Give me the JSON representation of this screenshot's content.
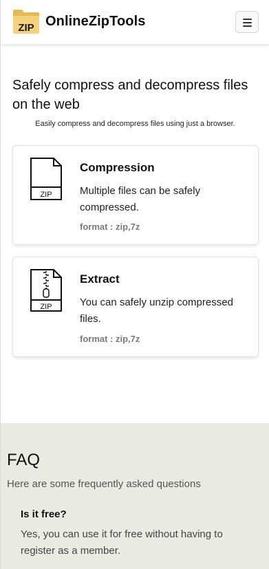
{
  "header": {
    "brand": "OnlineZipTools",
    "logo_text": "ZIP",
    "menu_icon": "hamburger-icon"
  },
  "hero": {
    "title": "Safely compress and decompress files on the web",
    "subtitle": "Easily compress and decompress files using just a browser."
  },
  "cards": [
    {
      "icon": "zip-file-icon",
      "icon_text": "ZIP",
      "title": "Compression",
      "description": "Multiple files can be safely compressed.",
      "format": "format : zip,7z"
    },
    {
      "icon": "zipper-file-icon",
      "icon_text": "ZIP",
      "title": "Extract",
      "description": "You can safely unzip compressed files.",
      "format": "format : zip,7z"
    }
  ],
  "faq": {
    "title": "FAQ",
    "subtitle": "Here are some frequently asked questions",
    "items": [
      {
        "question": "Is it free?",
        "answer": "Yes, you can use it for free without having to register as a member."
      }
    ]
  },
  "colors": {
    "logo_folder": "#f0c96a",
    "faq_background": "#e9ebe3",
    "format_text": "#7a7a7a"
  }
}
